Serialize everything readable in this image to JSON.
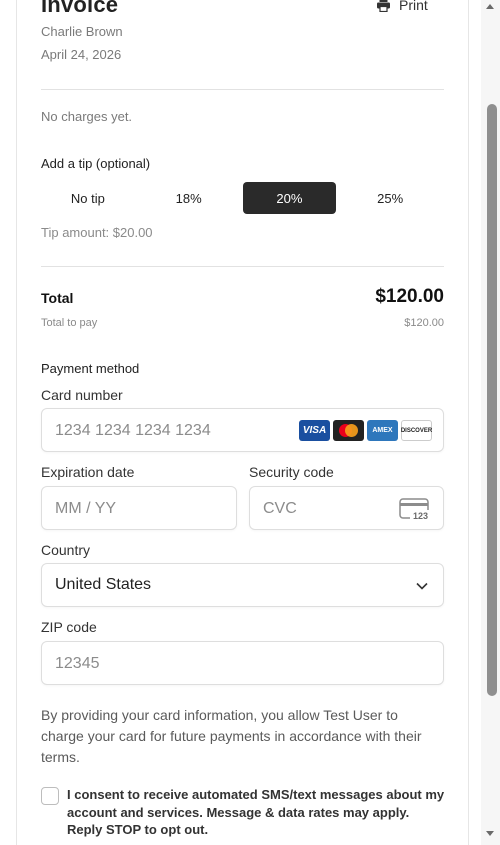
{
  "invoice": {
    "title": "Invoice",
    "print_label": "Print",
    "customer_name": "Charlie Brown",
    "date": "April 24, 2026",
    "no_charges": "No charges yet."
  },
  "tip": {
    "title": "Add a tip (optional)",
    "options": [
      "No tip",
      "18%",
      "20%",
      "25%"
    ],
    "selected_index": 2,
    "amount_text": "Tip amount: $20.00"
  },
  "totals": {
    "total_label": "Total",
    "total_value": "$120.00",
    "to_pay_label": "Total to pay",
    "to_pay_value": "$120.00"
  },
  "payment": {
    "title": "Payment method",
    "card_number_label": "Card number",
    "card_number_placeholder": "1234 1234 1234 1234",
    "card_brands": [
      "VISA",
      "mastercard",
      "AMEX",
      "DISCOVER"
    ],
    "expiration_label": "Expiration date",
    "expiration_placeholder": "MM / YY",
    "security_label": "Security code",
    "security_placeholder": "CVC",
    "cvc_icon_text": "123",
    "country_label": "Country",
    "country_value": "United States",
    "zip_label": "ZIP code",
    "zip_placeholder": "12345"
  },
  "consent": {
    "authorization_text": "By providing your card information, you allow Test User to charge your card for future payments in accordance with their terms.",
    "sms_text": "I consent to receive automated SMS/text messages about my account and services. Message & data rates may apply. Reply STOP to opt out.",
    "sms_checked": false
  },
  "colors": {
    "selected_tip_bg": "#2a2a2a",
    "visa_blue": "#1a4fa0",
    "amex_blue": "#2e77bc"
  },
  "icons": {
    "print": "printer-icon",
    "dropdown": "chevron-down-icon",
    "cvc": "card-cvc-icon"
  }
}
